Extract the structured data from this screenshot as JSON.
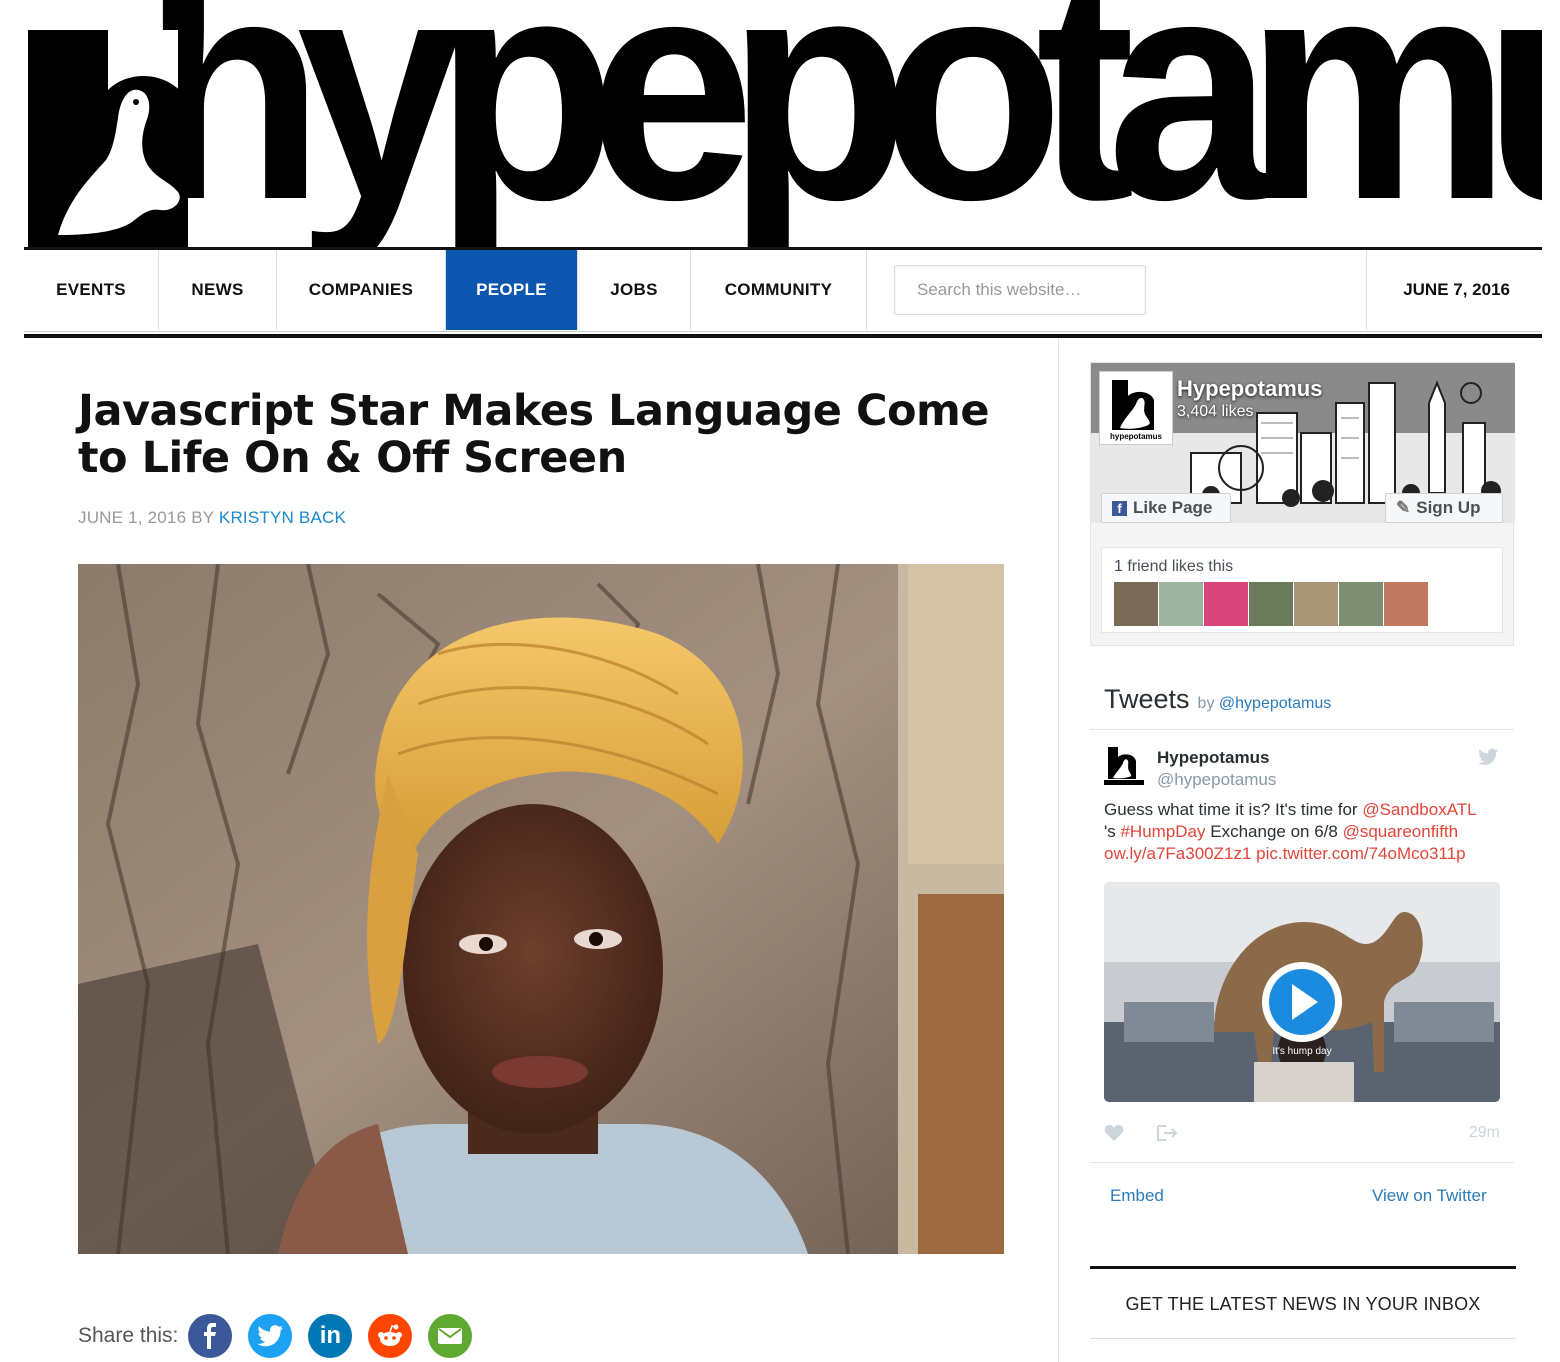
{
  "site": {
    "logo_text": "hypepotamus"
  },
  "nav": {
    "items": [
      {
        "label": "EVENTS",
        "active": false
      },
      {
        "label": "NEWS",
        "active": false
      },
      {
        "label": "COMPANIES",
        "active": false
      },
      {
        "label": "PEOPLE",
        "active": true
      },
      {
        "label": "JOBS",
        "active": false
      },
      {
        "label": "COMMUNITY",
        "active": false
      }
    ],
    "search_placeholder": "Search this website…",
    "date": "JUNE 7, 2016",
    "active_color": "#0d56b0"
  },
  "article": {
    "title": "Javascript Star Makes Language Come to Life On & Off Screen",
    "date": "JUNE 1, 2016",
    "by": "BY",
    "author": "KRISTYN BACK",
    "hero_image": "portrait-woman-yellow-headwrap-tree",
    "share_label": "Share this:",
    "share_buttons": [
      {
        "name": "facebook-share-button",
        "icon": "facebook-icon",
        "color": "#3b5998"
      },
      {
        "name": "twitter-share-button",
        "icon": "twitter-icon",
        "color": "#1da1f2"
      },
      {
        "name": "linkedin-share-button",
        "icon": "linkedin-icon",
        "color": "#0077b5"
      },
      {
        "name": "reddit-share-button",
        "icon": "reddit-icon",
        "color": "#ff4500"
      },
      {
        "name": "email-share-button",
        "icon": "email-icon",
        "color": "#5fa832"
      }
    ]
  },
  "facebook": {
    "page_name": "Hypepotamus",
    "likes": "3,404 likes",
    "avatar_caption": "hypepotamus",
    "like_button": "Like Page",
    "signup_button": "Sign Up",
    "friends_text": "1 friend likes this",
    "face_colors": [
      "#7a6a58",
      "#9db4a0",
      "#d8457a",
      "#6c7a5c",
      "#a89878",
      "#7d8f70",
      "#c07860",
      "#8a5a48"
    ]
  },
  "twitter": {
    "title": "Tweets",
    "by": "by",
    "by_handle": "@hypepotamus",
    "tweet": {
      "name": "Hypepotamus",
      "handle": "@hypepotamus",
      "text_1": "Guess what time it is? It's time for ",
      "link_1": "@SandboxATL",
      "text_2": " 's ",
      "link_2": "#HumpDay",
      "text_3": " Exchange on 6/8 ",
      "link_3": "@squareonfifth",
      "link_4": "ow.ly/a7Fa300Z1z1",
      "link_5": "pic.twitter.com/74oMco311p",
      "media_caption": "It's hump day",
      "time": "29m"
    },
    "embed": "Embed",
    "view_on_twitter": "View on Twitter",
    "link_color": "#e0463a"
  },
  "newsletter": {
    "heading": "GET THE LATEST NEWS IN YOUR INBOX"
  }
}
